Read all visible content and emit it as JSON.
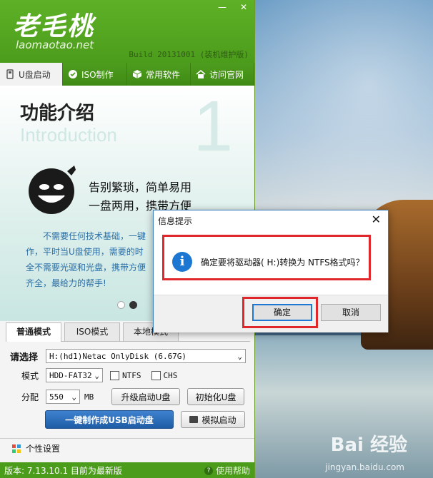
{
  "app": {
    "logo_text": "老毛桃",
    "logo_url": "laomaotao.net",
    "build": "Build 20131001 (装机维护版)",
    "nav_tabs": [
      {
        "label": "U盘启动",
        "icon": "usb-icon"
      },
      {
        "label": "ISO制作",
        "icon": "disc-icon"
      },
      {
        "label": "常用软件",
        "icon": "box-icon"
      },
      {
        "label": "访问官网",
        "icon": "home-icon"
      }
    ],
    "banner": {
      "title": "功能介绍",
      "title_en": "Introduction",
      "page_number": "1",
      "slogan_line1": "告别繁琐，简单易用",
      "slogan_line2": "一盘两用，携带方便",
      "desc_lines": [
        "不需要任何技术基础，一键",
        "作，平时当U盘使用，需要的时",
        "全不需要光驱和光盘，携带方便",
        "齐全，最给力的帮手!"
      ]
    },
    "mode_tabs": [
      "普通模式",
      "ISO模式",
      "本地模式"
    ],
    "form": {
      "select_label": "请选择",
      "device_value": "H:(hd1)Netac OnlyDisk (6.67G)",
      "mode_label": "模式",
      "mode_value": "HDD-FAT32",
      "ntfs_label": "NTFS",
      "chs_label": "CHS",
      "partition_label": "分配",
      "partition_value": "550",
      "partition_unit": "MB",
      "upgrade_button": "升级启动U盘",
      "init_button": "初始化U盘",
      "make_button": "一键制作成USB启动盘",
      "simulate_button": "模拟启动"
    },
    "settings_label": "个性设置",
    "status_version": "版本: 7.13.10.1 目前为最新版",
    "help_label": "使用帮助"
  },
  "dialog": {
    "title": "信息提示",
    "message": "确定要将驱动器( H:)转换为 NTFS格式吗？",
    "ok_label": "确定",
    "cancel_label": "取消"
  },
  "watermark": {
    "text": "Bai 经验",
    "url": "jingyan.baidu.com"
  }
}
